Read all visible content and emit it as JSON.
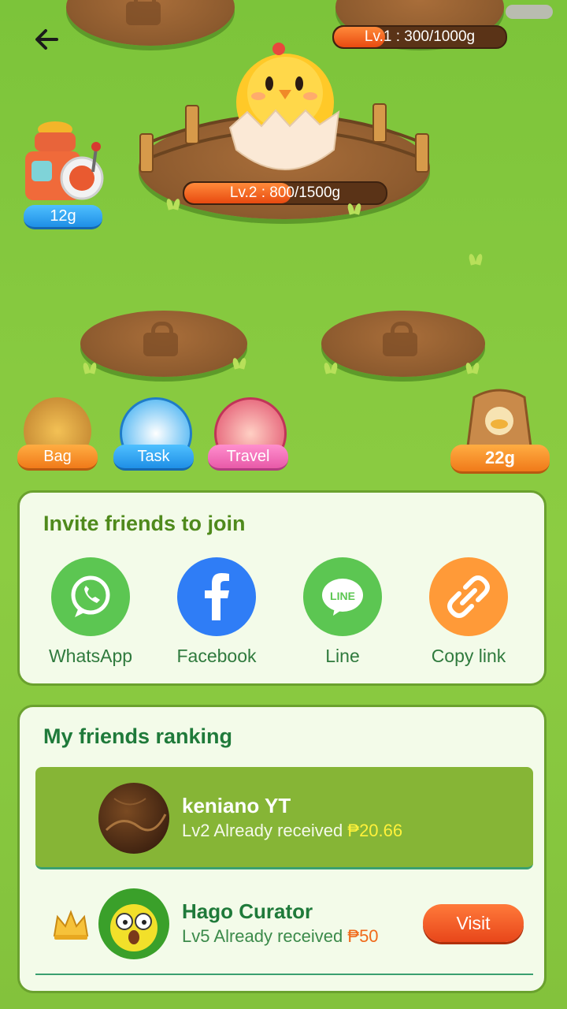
{
  "header": {
    "level1_label": "Lv.1 : 300/1000g",
    "level1_progress": 0.3,
    "level2_label": "Lv.2 : 800/1500g",
    "level2_progress": 0.53
  },
  "machine": {
    "amount": "12g"
  },
  "tools": {
    "bag": "Bag",
    "task": "Task",
    "travel": "Travel",
    "feed_amount": "22g"
  },
  "invite": {
    "title": "Invite friends to join",
    "options": [
      {
        "label": "WhatsApp",
        "icon": "whatsapp-icon",
        "color": "#5cc652"
      },
      {
        "label": "Facebook",
        "icon": "facebook-icon",
        "color": "#2f7df6"
      },
      {
        "label": "Line",
        "icon": "line-icon",
        "color": "#5cc652"
      },
      {
        "label": "Copy link",
        "icon": "link-icon",
        "color": "#ff9a38"
      }
    ]
  },
  "ranking": {
    "title": "My friends ranking",
    "rows": [
      {
        "name": "keniano YT",
        "level": "Lv2",
        "status": "Already received",
        "amount": "₱20.66"
      },
      {
        "name": "Hago Curator",
        "level": "Lv5",
        "status": "Already received",
        "amount": "₱50",
        "action": "Visit"
      }
    ]
  },
  "colors": {
    "accent_orange": "#ff8a2a",
    "task_blue": "#2aa6f0",
    "travel_pink": "#f06ab0",
    "highlight_row": "#86b536"
  }
}
